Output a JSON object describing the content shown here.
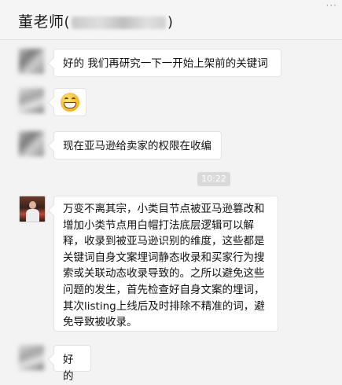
{
  "header": {
    "title_name": "董老师",
    "paren_open": "(",
    "paren_close": ")",
    "more_icon": "···"
  },
  "messages": [
    {
      "avatar": "blurred-avatar",
      "text": "好的 我们再研究一下一开始上架前的关键词"
    },
    {
      "avatar": "blurred-avatar",
      "emoji": "grin-emoji"
    },
    {
      "avatar": "blurred-avatar",
      "text": "现在亚马逊给卖家的权限在收编"
    },
    {
      "timestamp": "10:22"
    },
    {
      "avatar": "teacher-avatar",
      "text": "万变不离其宗，小类目节点被亚马逊篡改和增加小类节点用白帽打法底层逻辑可以解释，收录到被亚马逊识别的维度，这些都是关键词自身文案埋词静态收录和买家行为搜索或关联动态收录导致的。之所以避免这些问题的发生，首先检查好自身文案的埋词，其次listing上线后及时排除不精准的词，避免导致被收录。"
    },
    {
      "avatar": "blurred-avatar",
      "text": "好的"
    }
  ]
}
